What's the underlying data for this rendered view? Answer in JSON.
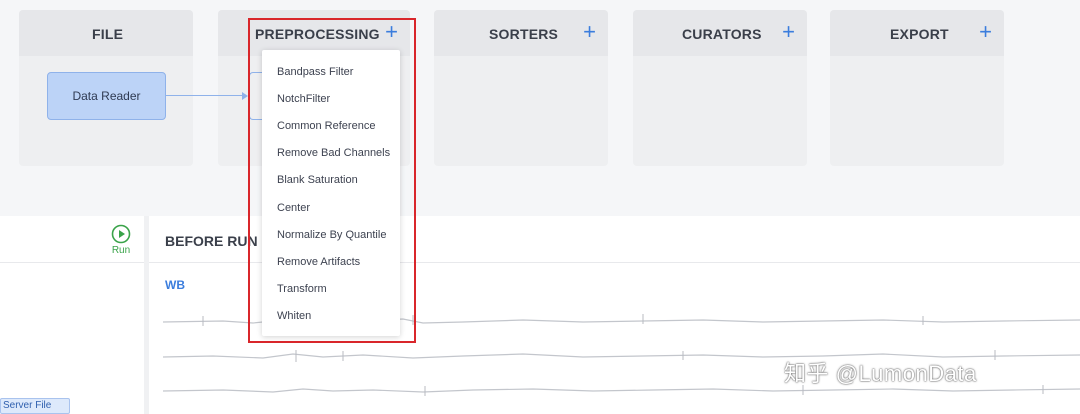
{
  "stages": {
    "file": {
      "title": "FILE"
    },
    "preprocessing": {
      "title": "PREPROCESSING",
      "add_label": "+"
    },
    "sorters": {
      "title": "SORTERS",
      "add_label": "+"
    },
    "curators": {
      "title": "CURATORS",
      "add_label": "+"
    },
    "export": {
      "title": "EXPORT",
      "add_label": "+"
    }
  },
  "nodes": {
    "data_reader": "Data Reader"
  },
  "dropdown": {
    "items": [
      "Bandpass Filter",
      "NotchFilter",
      "Common Reference",
      "Remove Bad Channels",
      "Blank Saturation",
      "Center",
      "Normalize By Quantile",
      "Remove Artifacts",
      "Transform",
      "Whiten"
    ]
  },
  "run": {
    "label": "Run"
  },
  "left_panel": {
    "server_file": "Server File"
  },
  "results": {
    "title": "BEFORE RUN",
    "channel_label": "WB"
  },
  "watermark": {
    "text": "知乎 @LumonData"
  },
  "colors": {
    "accent": "#3b7ddd",
    "node_fill": "#bcd3f7",
    "highlight": "#d9262b",
    "run_green": "#3aa34a"
  }
}
